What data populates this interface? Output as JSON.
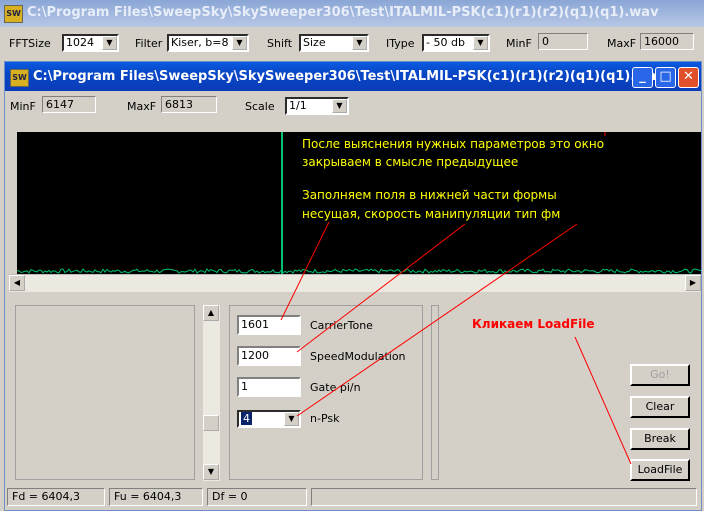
{
  "outer_window": {
    "icon_text": "SW",
    "title": "C:\\Program Files\\SweepSky\\SkySweeper306\\Test\\ITALMIL-PSK(c1)(r1)(r2)(q1)(q1).wav",
    "toolbar": {
      "fftsize_label": "FFTSize",
      "fftsize_value": "1024",
      "filter_label": "Filter",
      "filter_value": "Kiser, b=8",
      "shift_label": "Shift",
      "shift_value": "Size",
      "itype_label": "IType",
      "itype_value": "- 50 db",
      "minf_label": "MinF",
      "minf_value": "0",
      "maxf_label": "MaxF",
      "maxf_value": "16000"
    }
  },
  "inner_window": {
    "icon_text": "SW",
    "title": "C:\\Program Files\\SweepSky\\SkySweeper306\\Test\\ITALMIL-PSK(c1)(r1)(r2)(q1)(q1).wav",
    "toolbar": {
      "minf_label": "MinF",
      "minf_value": "6147",
      "maxf_label": "MaxF",
      "maxf_value": "6813",
      "scale_label": "Scale",
      "scale_value": "1/1"
    },
    "annotations": {
      "line1": "После выяснения нужных параметров это окно",
      "line2": "закрываем в смысле предыдущее",
      "line3": "Заполняем поля в нижней части формы",
      "line4": "несущая, скорость манипуляции тип фм",
      "loadfile_hint": "Кликаем LoadFile"
    },
    "params": {
      "carrier_value": "1601",
      "carrier_label": "CarrierTone",
      "speed_value": "1200",
      "speed_label": "SpeedModulation",
      "gate_value": "1",
      "gate_label": "Gate pi/n",
      "npsk_value": "4",
      "npsk_label": "n-Psk"
    },
    "buttons": {
      "go": "Go!",
      "clear": "Clear",
      "break": "Break",
      "loadfile": "LoadFile"
    },
    "status": {
      "fd": "Fd = 6404,3",
      "fu": "Fu = 6404,3",
      "df": "Df = 0"
    }
  },
  "colors": {
    "annotation": "#ffff00",
    "hint": "#ff0000",
    "spectrum": "#00c070",
    "arrow": "#ff0000"
  }
}
